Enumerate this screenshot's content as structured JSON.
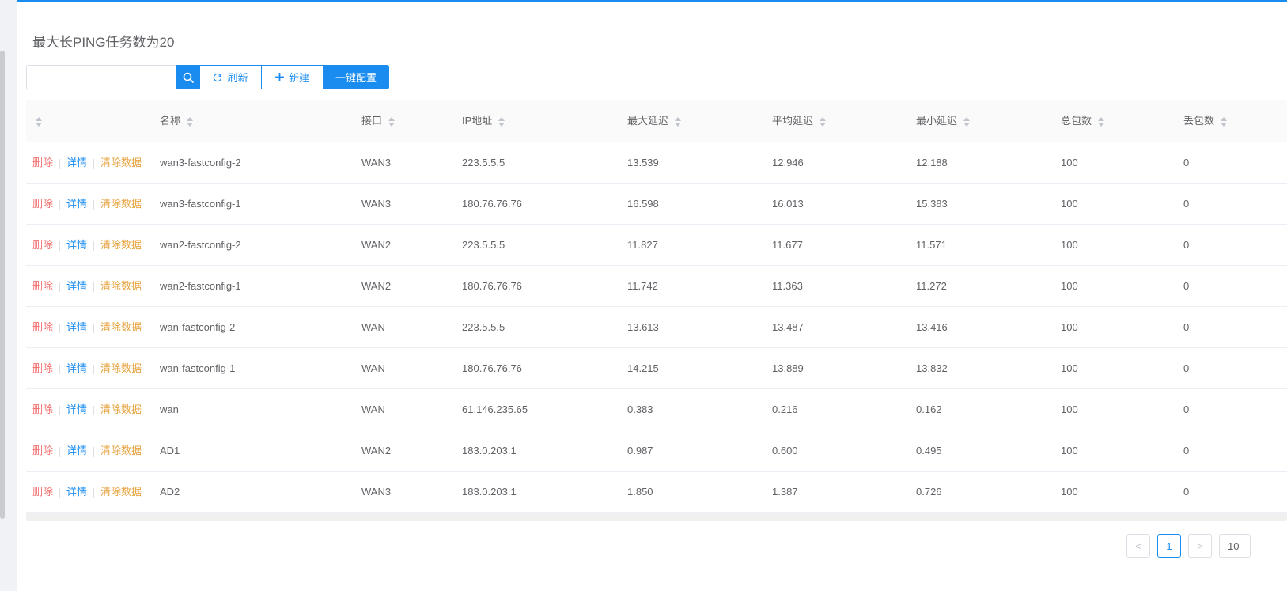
{
  "header": {
    "title": "最大长PING任务数为20"
  },
  "search": {
    "placeholder": "",
    "value": ""
  },
  "toolbar": {
    "refresh_label": "刷新",
    "new_label": "新建",
    "quick_config_label": "一键配置"
  },
  "columns": {
    "name": "名称",
    "interface": "接口",
    "ip": "IP地址",
    "max_delay": "最大延迟",
    "avg_delay": "平均延迟",
    "min_delay": "最小延迟",
    "total_packets": "总包数",
    "lost_packets": "丢包数"
  },
  "actions": {
    "delete": "删除",
    "detail": "详情",
    "clear": "清除数据"
  },
  "rows": [
    {
      "name": "wan3-fastconfig-2",
      "interface": "WAN3",
      "ip": "223.5.5.5",
      "max": "13.539",
      "avg": "12.946",
      "min": "12.188",
      "total": "100",
      "lost": "0"
    },
    {
      "name": "wan3-fastconfig-1",
      "interface": "WAN3",
      "ip": "180.76.76.76",
      "max": "16.598",
      "avg": "16.013",
      "min": "15.383",
      "total": "100",
      "lost": "0"
    },
    {
      "name": "wan2-fastconfig-2",
      "interface": "WAN2",
      "ip": "223.5.5.5",
      "max": "11.827",
      "avg": "11.677",
      "min": "11.571",
      "total": "100",
      "lost": "0"
    },
    {
      "name": "wan2-fastconfig-1",
      "interface": "WAN2",
      "ip": "180.76.76.76",
      "max": "11.742",
      "avg": "11.363",
      "min": "11.272",
      "total": "100",
      "lost": "0"
    },
    {
      "name": "wan-fastconfig-2",
      "interface": "WAN",
      "ip": "223.5.5.5",
      "max": "13.613",
      "avg": "13.487",
      "min": "13.416",
      "total": "100",
      "lost": "0"
    },
    {
      "name": "wan-fastconfig-1",
      "interface": "WAN",
      "ip": "180.76.76.76",
      "max": "14.215",
      "avg": "13.889",
      "min": "13.832",
      "total": "100",
      "lost": "0"
    },
    {
      "name": "wan",
      "interface": "WAN",
      "ip": "61.146.235.65",
      "max": "0.383",
      "avg": "0.216",
      "min": "0.162",
      "total": "100",
      "lost": "0"
    },
    {
      "name": "AD1",
      "interface": "WAN2",
      "ip": "183.0.203.1",
      "max": "0.987",
      "avg": "0.600",
      "min": "0.495",
      "total": "100",
      "lost": "0"
    },
    {
      "name": "AD2",
      "interface": "WAN3",
      "ip": "183.0.203.1",
      "max": "1.850",
      "avg": "1.387",
      "min": "0.726",
      "total": "100",
      "lost": "0"
    }
  ],
  "pagination": {
    "prev": "<",
    "current": "1",
    "next": ">",
    "page_size": "10"
  },
  "colors": {
    "primary": "#1a8cf0",
    "danger": "#f56c6c",
    "warning": "#e6a23c"
  }
}
